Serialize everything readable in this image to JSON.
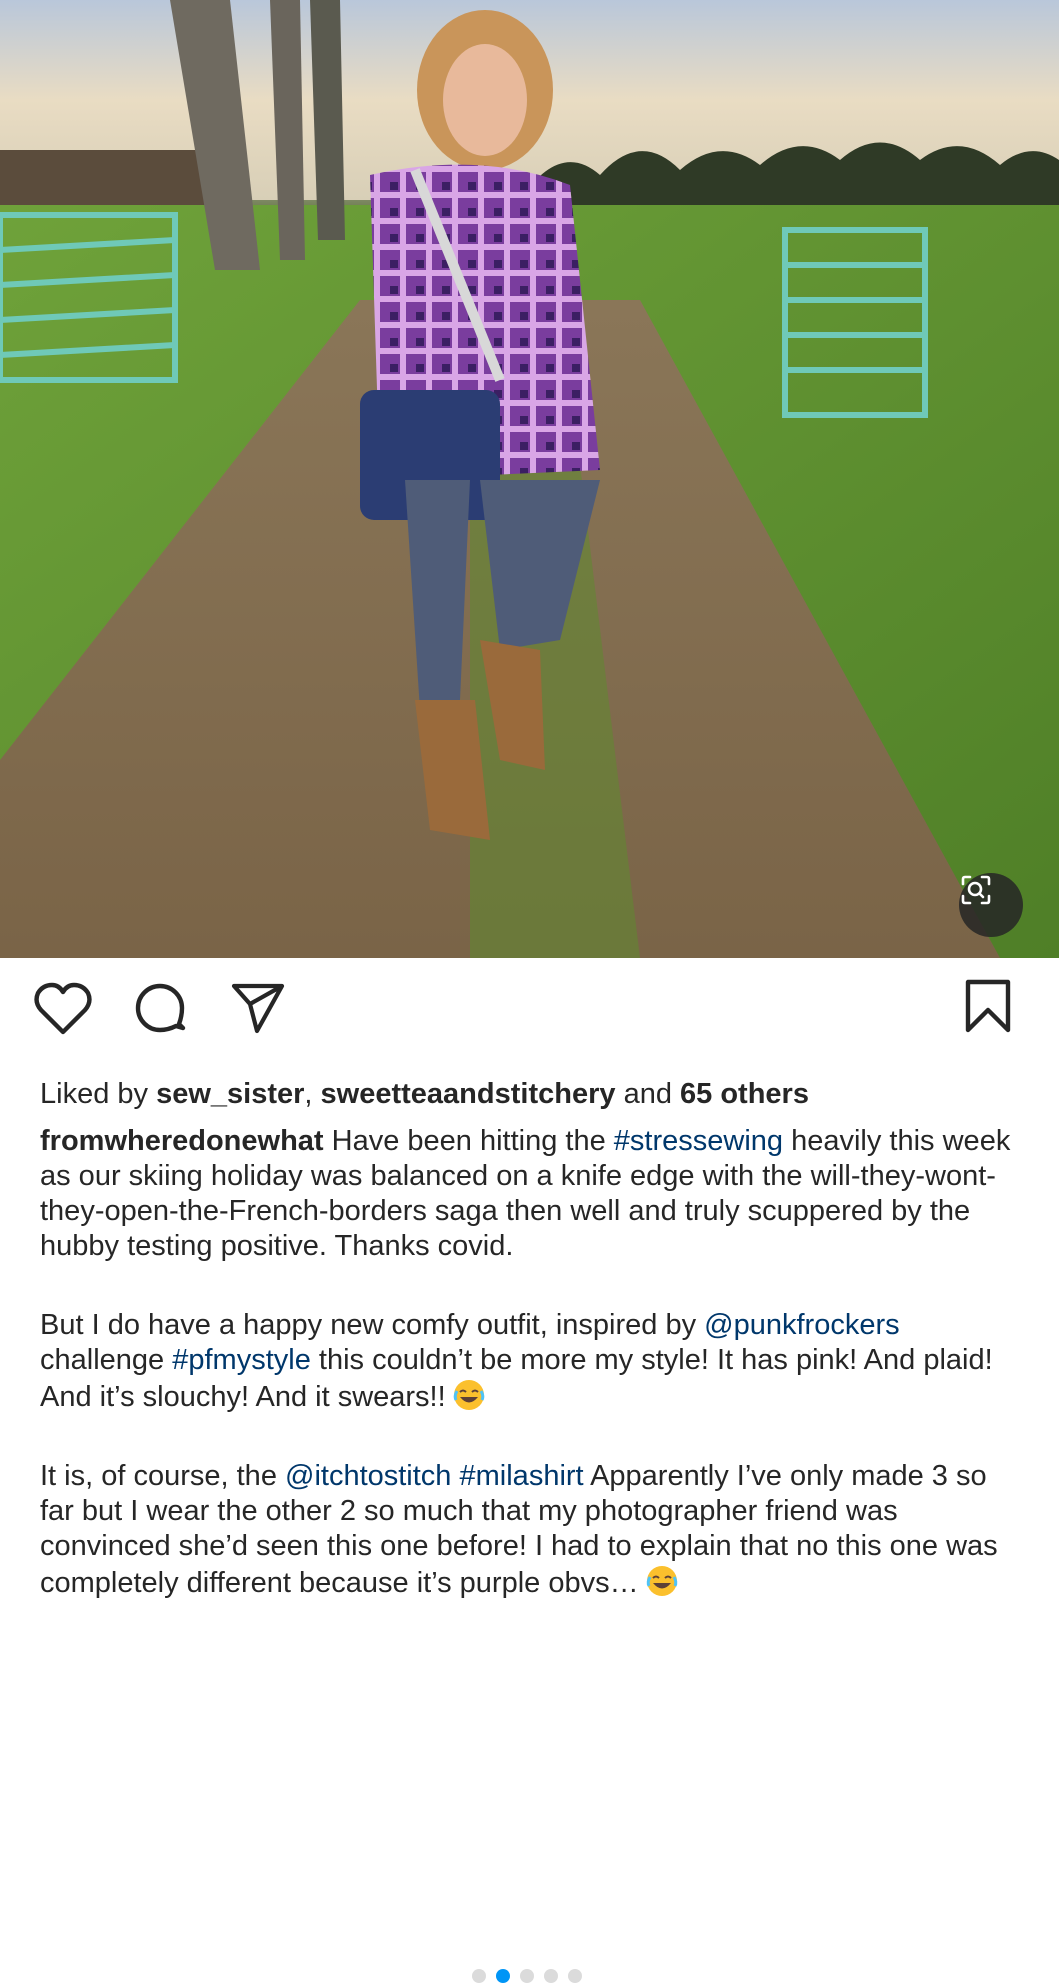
{
  "post": {
    "photo_alt_icon": "visual-search-icon",
    "carousel": {
      "count": 5,
      "active_index": 1
    },
    "likes": {
      "prefix": "Liked by",
      "user1": "sew_sister",
      "separator": ",",
      "user2": "sweetteaandstitchery",
      "and": "and",
      "others": "65 others"
    },
    "caption": {
      "username": "fromwheredonewhat",
      "p1_a": " Have been hitting the ",
      "tag_stressewing": "#stressewing",
      "p1_b": " heavily this week as our skiing holiday was balanced on a knife edge with the will-they-wont-they-open-the-French-borders saga then well and truly scuppered by the hubby testing positive. Thanks covid.",
      "p2_a": "But I do have a happy new comfy outfit, inspired by ",
      "mention_punkfrockers": "@punkfrockers",
      "p2_b": " challenge ",
      "tag_pfmystyle": "#pfmystyle",
      "p2_c": " this couldn’t be more my style! It has pink! And plaid! And it’s slouchy! And it swears!!",
      "p3_a": "It is, of course, the ",
      "mention_itchtostitch": "@itchtostitch",
      "p3_sp": " ",
      "tag_milashirt": "#milashirt",
      "p3_b": " Apparently I’ve only made 3 so far but I wear the other 2 so much that my photographer friend was convinced she’d seen this one before! I had to explain that no this one was completely different because it’s purple obvs…"
    }
  },
  "icons": {
    "like": "heart-icon",
    "comment": "comment-icon",
    "share": "paper-plane-icon",
    "save": "bookmark-icon",
    "emoji": "laughing-emoji-icon"
  },
  "colors": {
    "link": "#00376b",
    "dot_active": "#0095f6",
    "dot_inactive": "#dbdbdb"
  }
}
